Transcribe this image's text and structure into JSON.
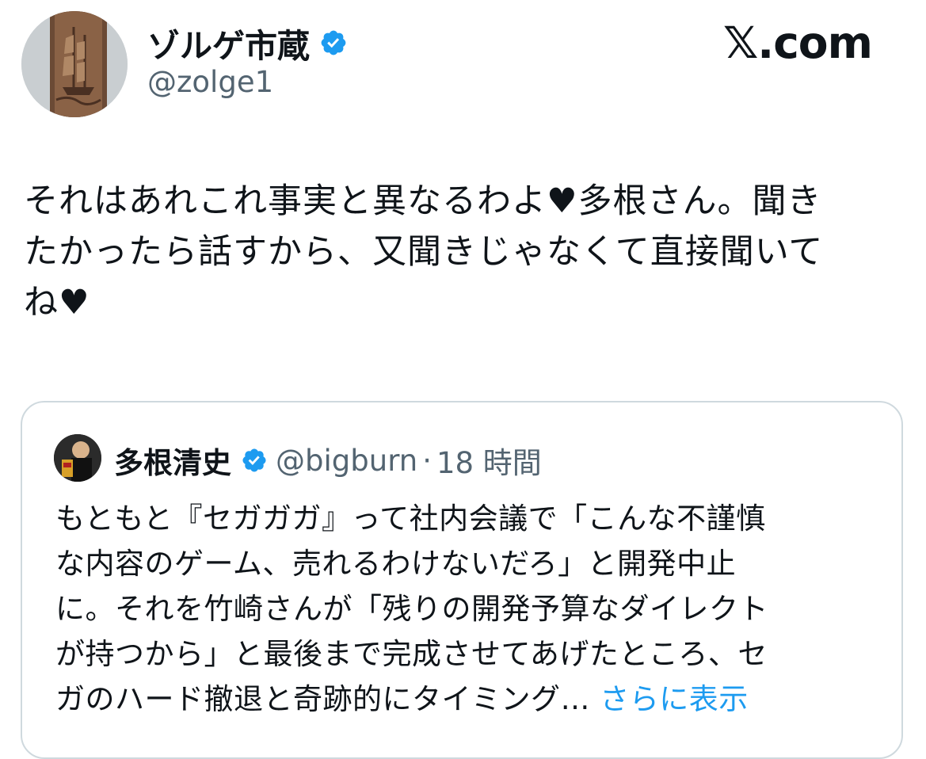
{
  "author": {
    "display_name": "ゾルゲ市蔵",
    "handle": "@zolge1",
    "verified_icon": "verified-badge-icon"
  },
  "brand": {
    "logo_text": "𝕏.com"
  },
  "tweet": {
    "text": "それはあれこれ事実と異なるわよ♥多根さん。聞き\nたかったら話すから、又聞きじゃなくて直接聞いて\nね♥"
  },
  "quote": {
    "display_name": "多根清史",
    "handle": "@bigburn",
    "separator": "·",
    "time": "18 時間",
    "text": "もともと『セガガガ』って社内会議で「こんな不謹慎\nな内容のゲーム、売れるわけないだろ」と開発中止\nに。それを竹崎さんが「残りの開発予算なダイレクト\nが持つから」と最後まで完成させてあげたところ、セ\nガのハード撤退と奇跡的にタイミング… ",
    "show_more": "さらに表示"
  },
  "colors": {
    "verified": "#1d9bf0",
    "link": "#1d9bf0",
    "secondary_text": "#536471",
    "border": "#cfd9de"
  }
}
